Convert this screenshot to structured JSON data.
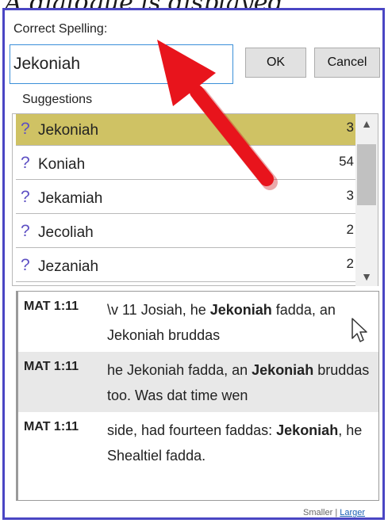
{
  "caption": "A dialogue is displayed",
  "dialog": {
    "correct_spelling_label": "Correct Spelling:",
    "input_value": "Jekoniah",
    "ok_label": "OK",
    "cancel_label": "Cancel"
  },
  "suggestions": {
    "title": "Suggestions",
    "items": [
      {
        "word": "Jekoniah",
        "count": "3",
        "selected": true
      },
      {
        "word": "Koniah",
        "count": "54",
        "selected": false
      },
      {
        "word": "Jekamiah",
        "count": "3",
        "selected": false
      },
      {
        "word": "Jecoliah",
        "count": "2",
        "selected": false
      },
      {
        "word": "Jezaniah",
        "count": "2",
        "selected": false
      }
    ],
    "icon": "question-mark-icon",
    "selected_color": "#cfc264"
  },
  "references": [
    {
      "label": "MAT 1:11",
      "parts": [
        {
          "text": "\\v 11 Josiah, he ",
          "bold": false
        },
        {
          "text": "Jekoniah",
          "bold": true
        },
        {
          "text": " fadda, an Jekoniah bruddas",
          "bold": false
        }
      ],
      "shaded": false
    },
    {
      "label": "MAT 1:11",
      "parts": [
        {
          "text": "he Jekoniah fadda, an ",
          "bold": false
        },
        {
          "text": "Jekoniah",
          "bold": true
        },
        {
          "text": " bruddas too. Was dat time wen",
          "bold": false
        }
      ],
      "shaded": true
    },
    {
      "label": "MAT 1:11",
      "parts": [
        {
          "text": "side, had fourteen faddas: ",
          "bold": false
        },
        {
          "text": "Jekoniah",
          "bold": true
        },
        {
          "text": ", he Shealtiel fadda.",
          "bold": false
        }
      ],
      "shaded": false
    }
  ],
  "footer": {
    "smaller": "Smaller",
    "separator": "|",
    "larger": "Larger"
  },
  "colors": {
    "dialog_border": "#4a46c4",
    "input_border": "#3b8fd9",
    "annotation_arrow": "#e8141c",
    "question_mark": "#5d4fc3"
  }
}
